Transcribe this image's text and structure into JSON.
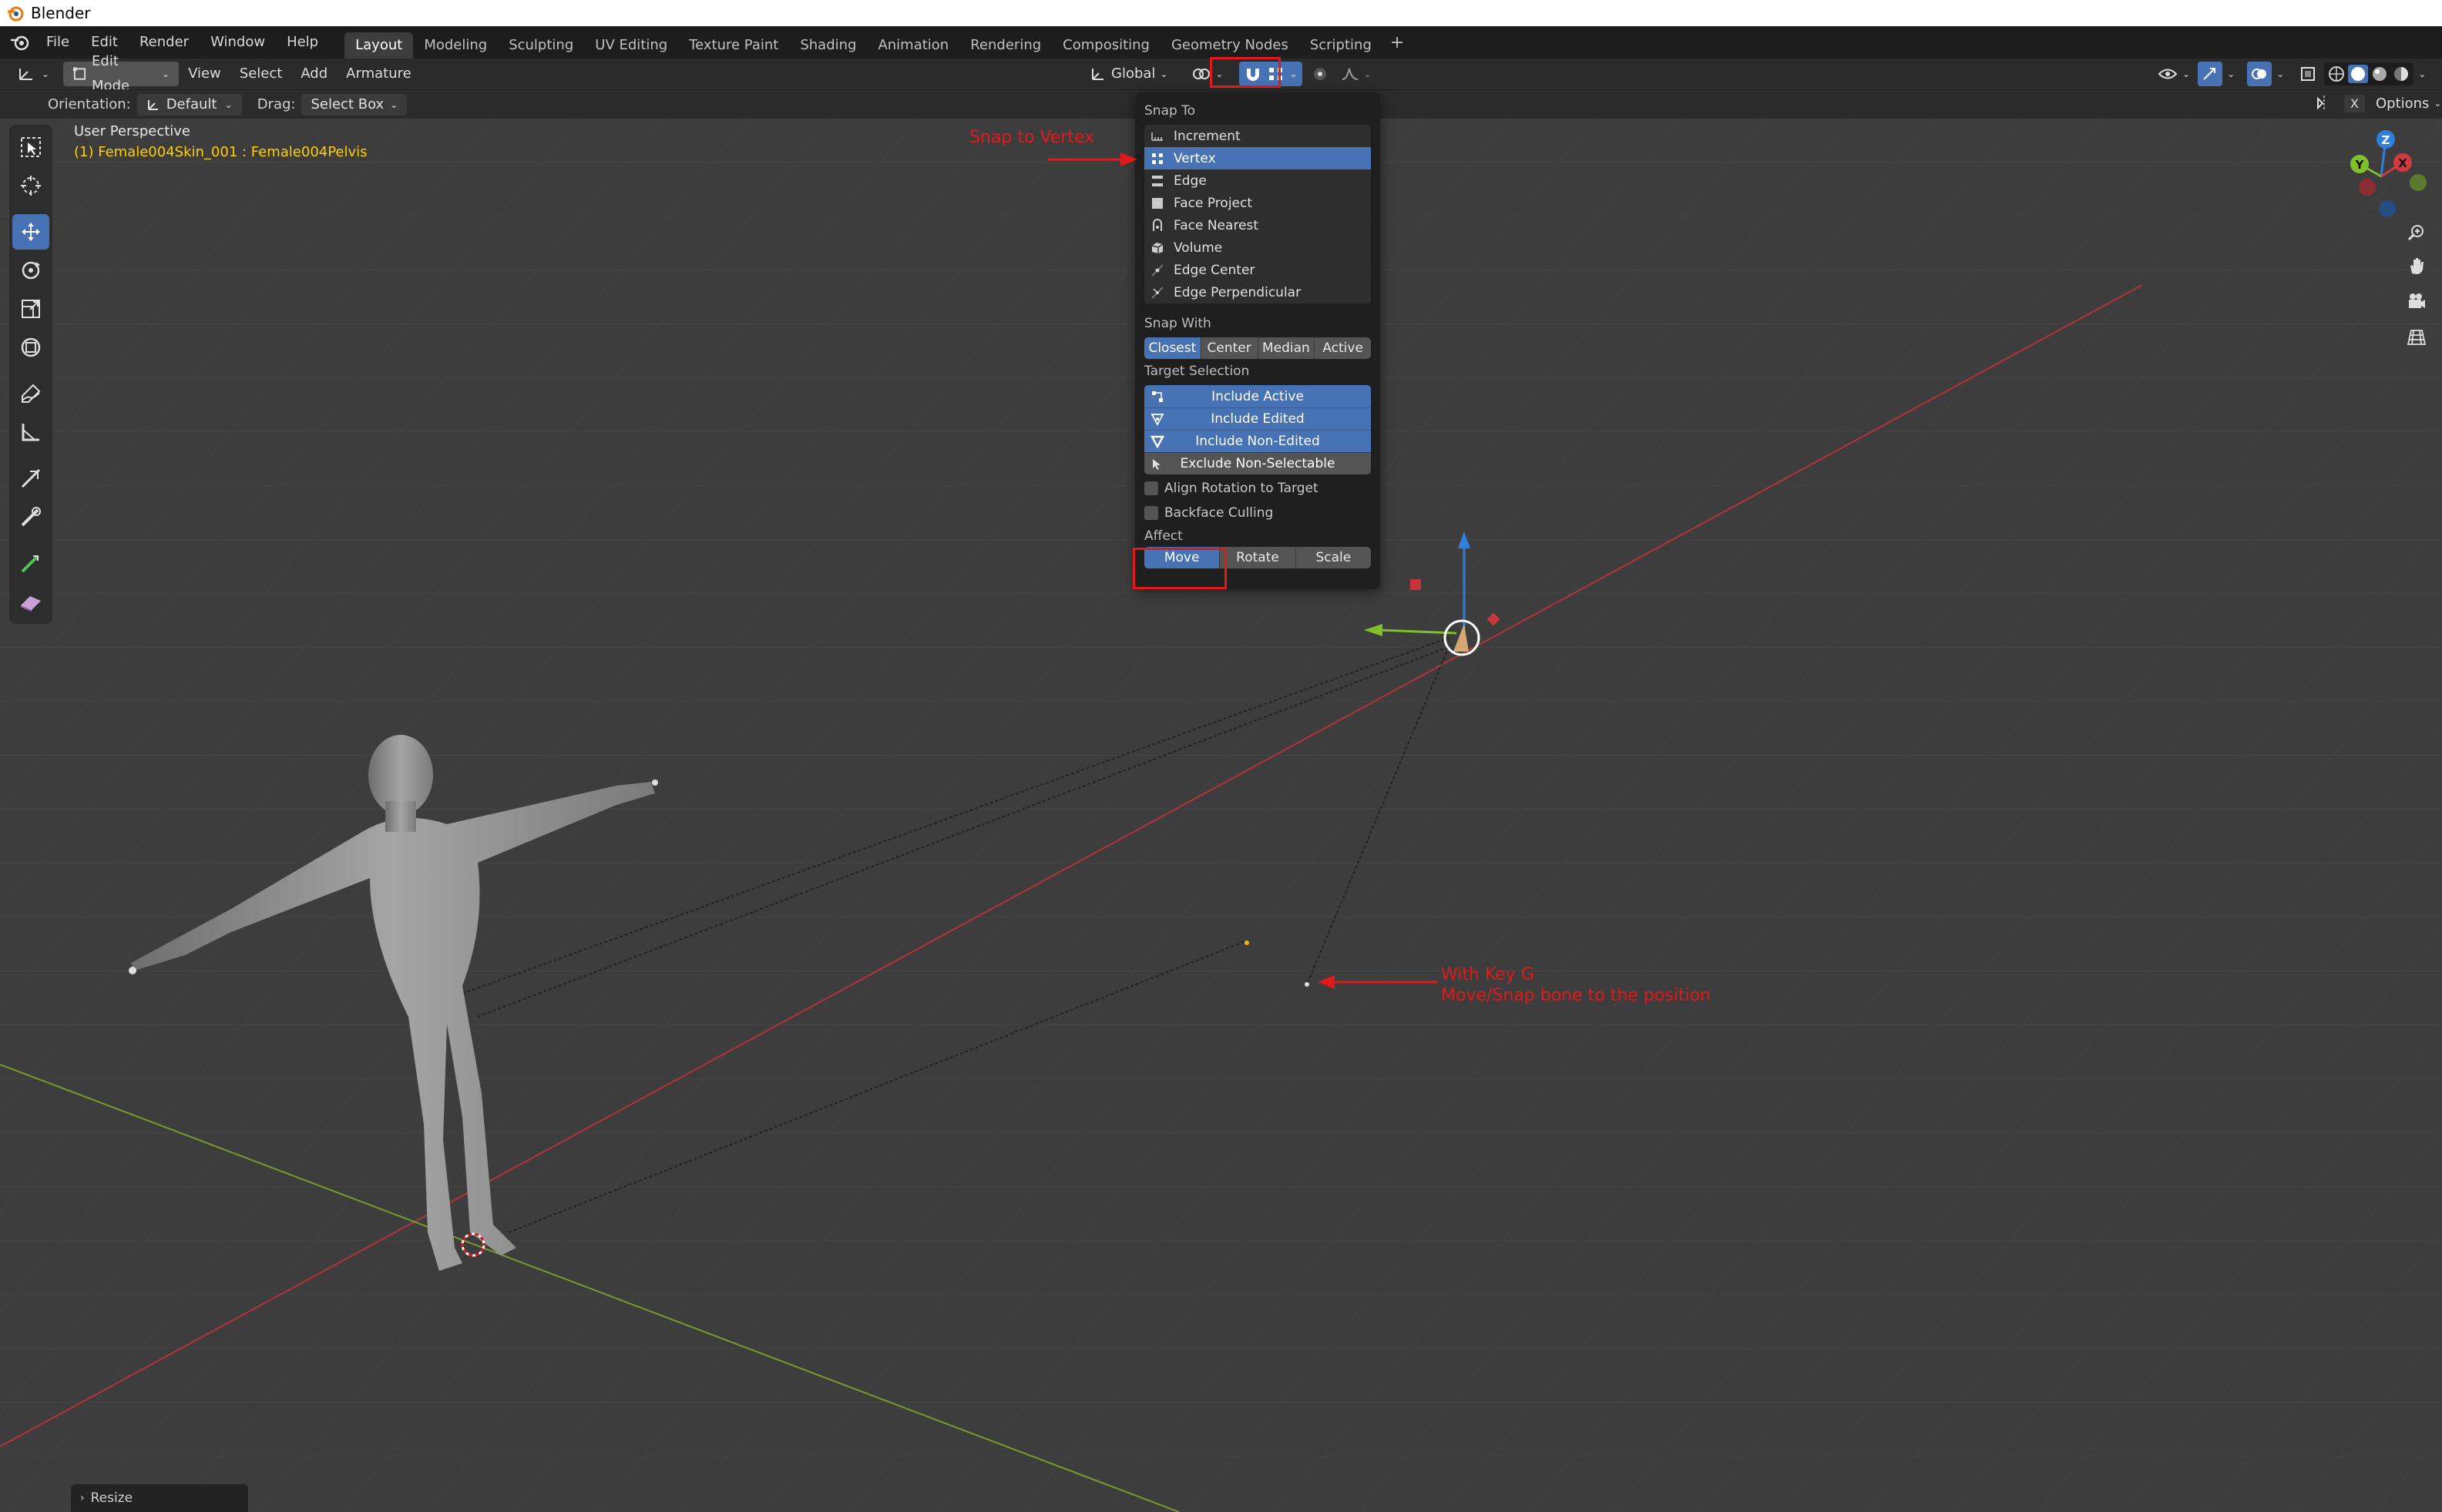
{
  "window": {
    "title": "Blender"
  },
  "menu": [
    "File",
    "Edit",
    "Render",
    "Window",
    "Help"
  ],
  "workspaces": [
    "Layout",
    "Modeling",
    "Sculpting",
    "UV Editing",
    "Texture Paint",
    "Shading",
    "Animation",
    "Rendering",
    "Compositing",
    "Geometry Nodes",
    "Scripting"
  ],
  "active_workspace": "Layout",
  "header": {
    "mode": "Edit Mode",
    "view": "View",
    "select": "Select",
    "add": "Add",
    "armature": "Armature",
    "transform_orientation": "Global",
    "options": "Options"
  },
  "tool_settings": {
    "orientation_label": "Orientation:",
    "orientation_value": "Default",
    "drag_label": "Drag:",
    "drag_value": "Select Box"
  },
  "viewport": {
    "title": "User Perspective",
    "object": "(1) Female004Skin_001 : Female004Pelvis"
  },
  "snap_popover": {
    "snap_to_label": "Snap To",
    "snap_to": [
      "Increment",
      "Vertex",
      "Edge",
      "Face Project",
      "Face Nearest",
      "Volume",
      "Edge Center",
      "Edge Perpendicular"
    ],
    "snap_to_selected": "Vertex",
    "snap_with_label": "Snap With",
    "snap_with": [
      "Closest",
      "Center",
      "Median",
      "Active"
    ],
    "snap_with_selected": "Closest",
    "target_selection_label": "Target Selection",
    "target_selection": [
      {
        "label": "Include Active",
        "on": true
      },
      {
        "label": "Include Edited",
        "on": true
      },
      {
        "label": "Include Non-Edited",
        "on": true
      },
      {
        "label": "Exclude Non-Selectable",
        "on": false
      }
    ],
    "align_rotation": "Align Rotation to Target",
    "backface_culling": "Backface Culling",
    "affect_label": "Affect",
    "affect": [
      "Move",
      "Rotate",
      "Scale"
    ],
    "affect_selected": "Move"
  },
  "annotations": {
    "snap_vertex": "Snap to Vertex",
    "key_g_line1": "With Key G",
    "key_g_line2": "Move/Snap bone to the position"
  },
  "axis_labels": {
    "x": "X",
    "y": "Y",
    "z": "Z"
  },
  "footer": {
    "resize": "Resize"
  },
  "colors": {
    "accent": "#4772b3",
    "annotation": "#e0191b",
    "object_text": "#ffd000"
  }
}
